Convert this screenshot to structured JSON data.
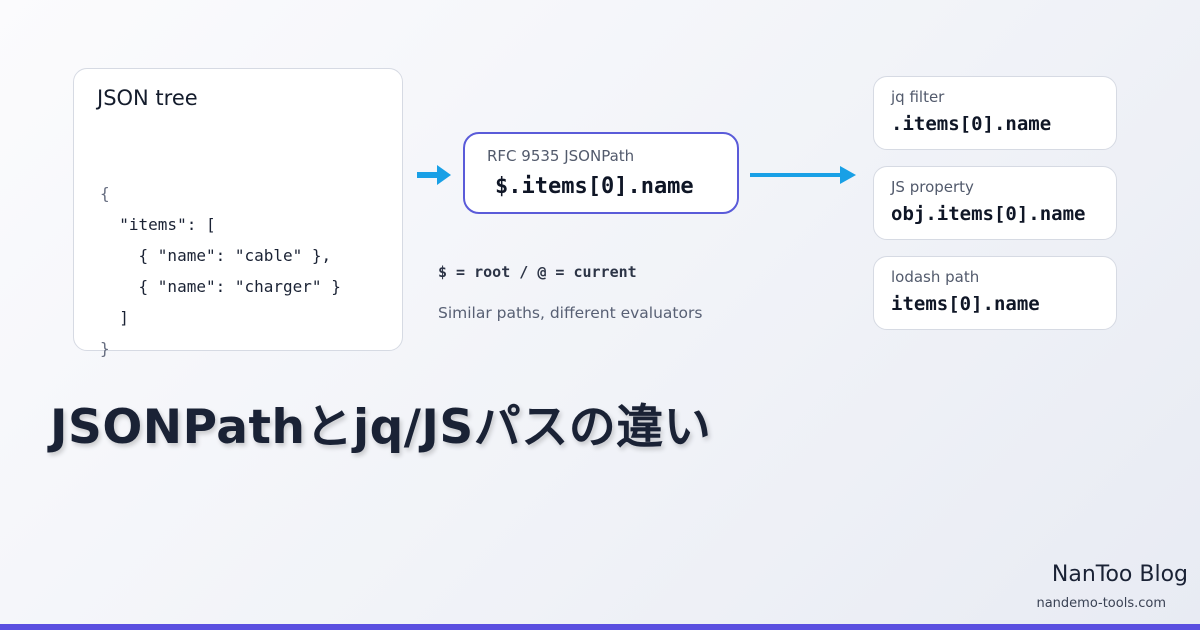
{
  "tree_card": {
    "title": "JSON tree",
    "lines": [
      "{",
      "  \"items\": [",
      "    { \"name\": \"cable\" },",
      "    { \"name\": \"charger\" }",
      "  ]",
      "}"
    ]
  },
  "jsonpath_card": {
    "label": "RFC 9535 JSONPath",
    "expression": "$.items[0].name"
  },
  "legend": "$ = root / @ = current",
  "caption": "Similar paths, different evaluators",
  "right_cards": [
    {
      "label": "jq filter",
      "value": ".items[0].name"
    },
    {
      "label": "JS property",
      "value": "obj.items[0].name"
    },
    {
      "label": "lodash path",
      "value": "items[0].name"
    }
  ],
  "headline": "JSONPathとjq/JSパスの違い",
  "brand": {
    "name": "NanToo Blog",
    "url": "nandemo-tools.com"
  },
  "colors": {
    "accent": "#5a5bd9",
    "arrow": "#19a0e6",
    "bar": "#5a4fe0"
  }
}
